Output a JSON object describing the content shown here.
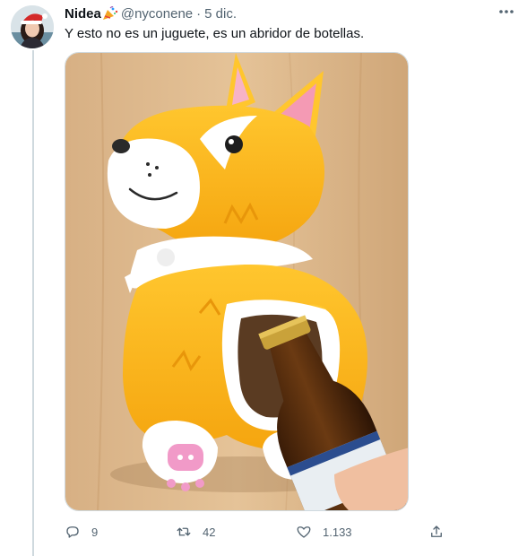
{
  "tweet": {
    "author_name": "Nidea",
    "author_emoji": "party-popper-icon",
    "handle": "@nyconene",
    "separator": "·",
    "date": "5 dic.",
    "text": "Y esto no es un juguete, es un abridor de botellas.",
    "image_alt": "Abridor de botellas con forma de corgi"
  },
  "actions": {
    "replies": "9",
    "retweets": "42",
    "likes": "1.133"
  },
  "colors": {
    "text_primary": "#0f1419",
    "text_secondary": "#536471",
    "thread_line": "#cfd9de"
  }
}
